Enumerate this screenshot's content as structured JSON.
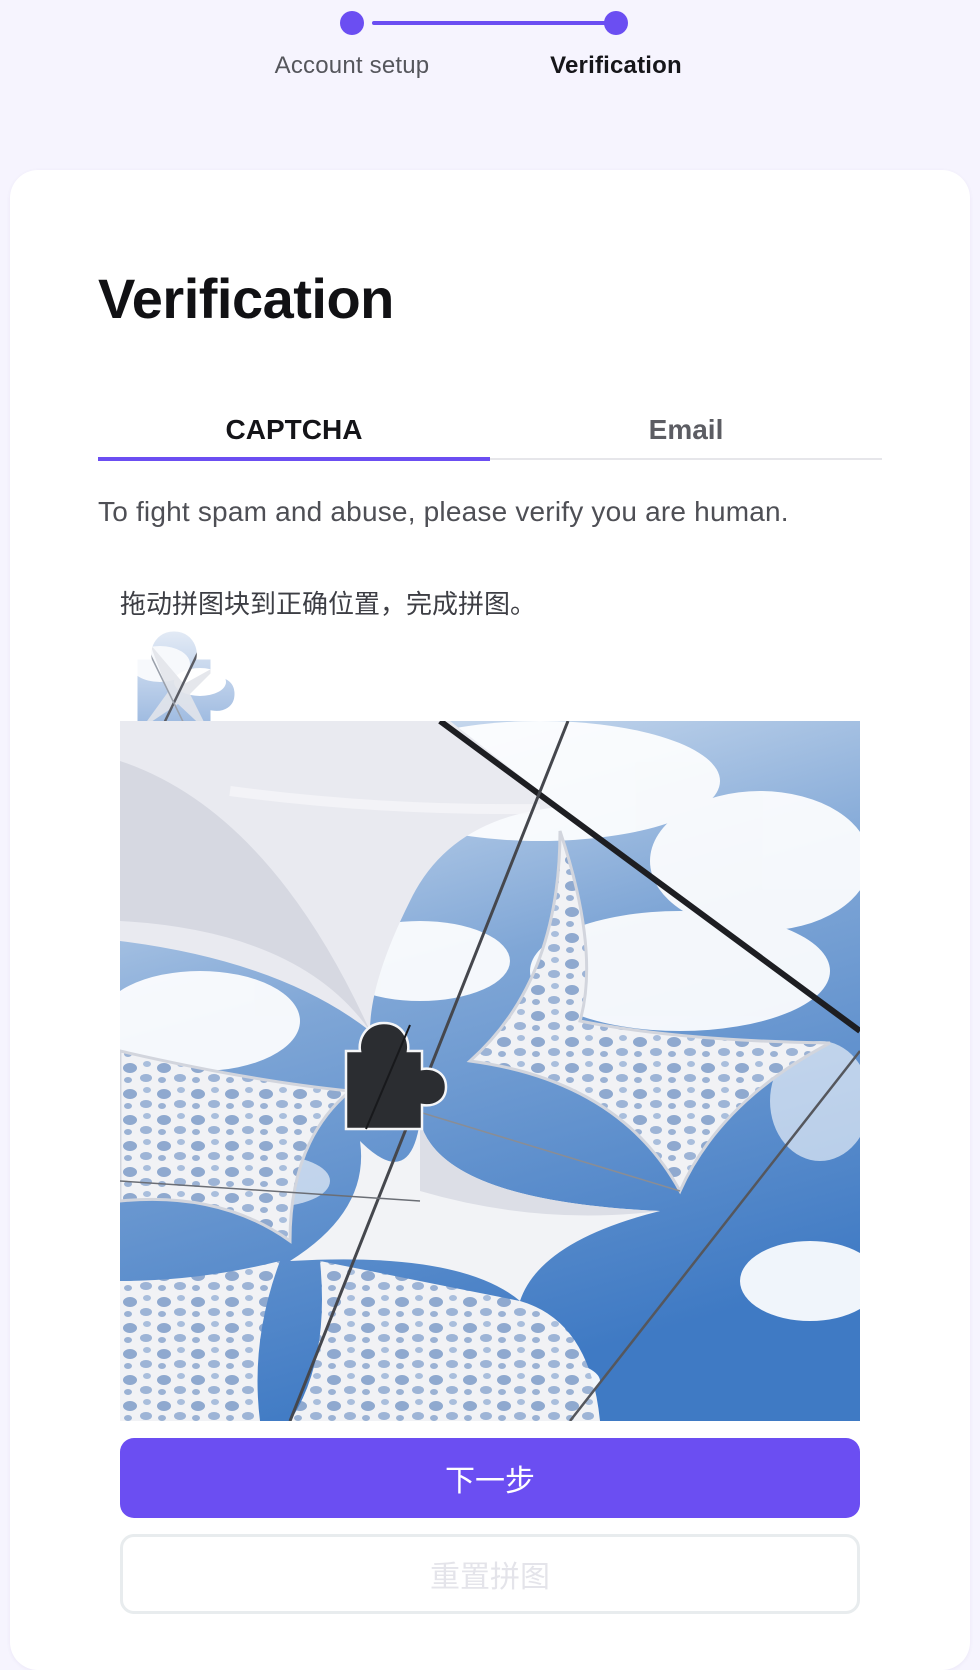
{
  "stepper": {
    "steps": [
      {
        "label": "Account setup",
        "state": "complete"
      },
      {
        "label": "Verification",
        "state": "active"
      }
    ],
    "accent_color": "#6b4ef2"
  },
  "card": {
    "title": "Verification",
    "tabs": [
      {
        "label": "CAPTCHA",
        "selected": true
      },
      {
        "label": "Email",
        "selected": false
      }
    ],
    "subtitle": "To fight spam and abuse, please verify you are human."
  },
  "captcha": {
    "instruction": "拖动拼图块到正确位置，完成拼图。",
    "piece_icon": "puzzle-piece-icon",
    "image_description_icon": "sky-canopy-image",
    "next_button": "下一步",
    "reset_button": "重置拼图"
  },
  "colors": {
    "accent": "#6b4ef2",
    "page_background": "#f6f4fe",
    "card_background": "#ffffff"
  }
}
